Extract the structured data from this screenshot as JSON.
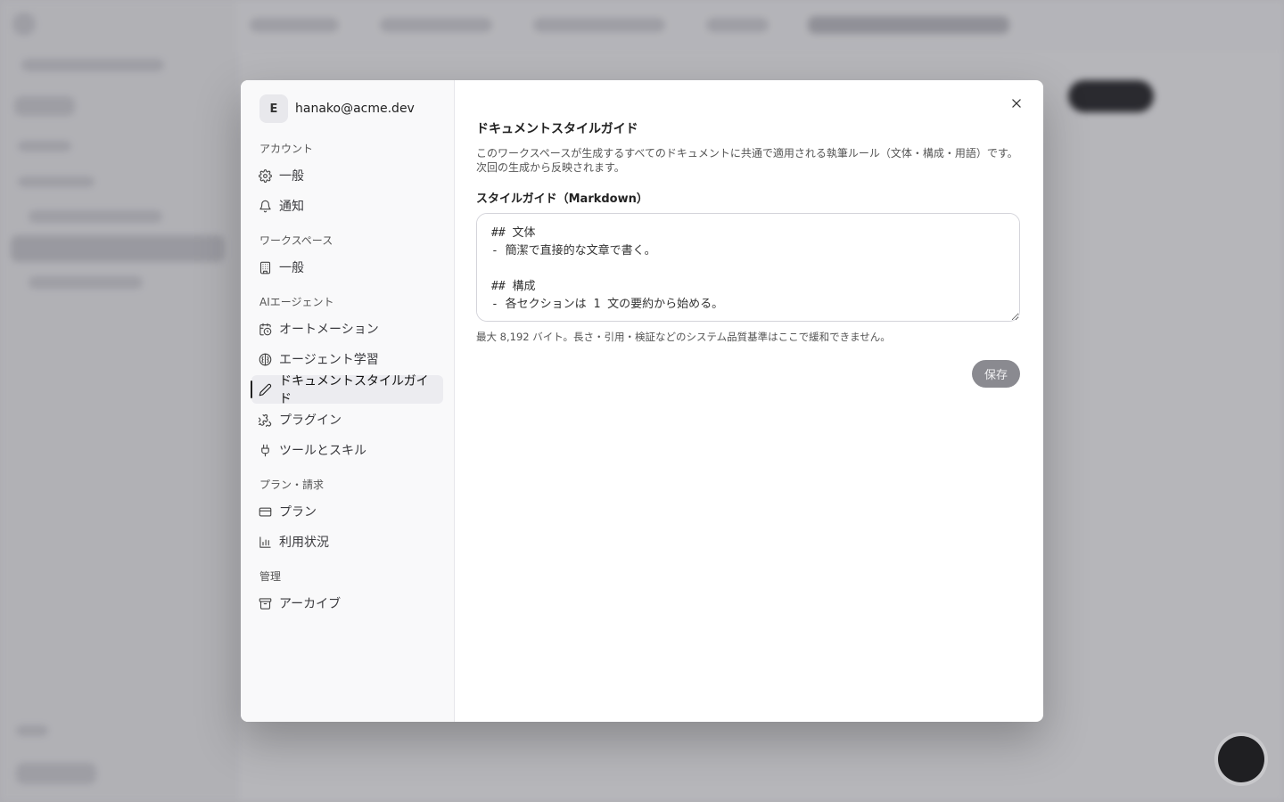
{
  "account": {
    "initial": "E",
    "email": "hanako@acme.dev"
  },
  "nav": {
    "groups": [
      {
        "label": "アカウント",
        "items": [
          {
            "label": "一般",
            "icon": "gear-icon"
          },
          {
            "label": "通知",
            "icon": "bell-icon"
          }
        ]
      },
      {
        "label": "ワークスペース",
        "items": [
          {
            "label": "一般",
            "icon": "building-icon"
          }
        ]
      },
      {
        "label": "AIエージェント",
        "items": [
          {
            "label": "オートメーション",
            "icon": "calendar-clock-icon"
          },
          {
            "label": "エージェント学習",
            "icon": "brain-icon"
          },
          {
            "label": "ドキュメントスタイルガイド",
            "icon": "pen-icon",
            "active": true
          },
          {
            "label": "プラグイン",
            "icon": "puzzle-icon"
          },
          {
            "label": "ツールとスキル",
            "icon": "plug-icon"
          }
        ]
      },
      {
        "label": "プラン・請求",
        "items": [
          {
            "label": "プラン",
            "icon": "credit-card-icon"
          },
          {
            "label": "利用状況",
            "icon": "bar-chart-icon"
          }
        ]
      },
      {
        "label": "管理",
        "items": [
          {
            "label": "アーカイブ",
            "icon": "archive-icon"
          }
        ]
      }
    ]
  },
  "main": {
    "title": "ドキュメントスタイルガイド",
    "description": "このワークスペースが生成するすべてのドキュメントに共通で適用される執筆ルール（文体・構成・用語）です。次回の生成から反映されます。",
    "field_label": "スタイルガイド（Markdown）",
    "textarea_value": "## 文体\n- 簡潔で直接的な文章で書く。\n\n## 構成\n- 各セクションは 1 文の要約から始める。",
    "hint": "最大 8,192 バイト。長さ・引用・検証などのシステム品質基準はここで緩和できません。",
    "save_label": "保存"
  }
}
